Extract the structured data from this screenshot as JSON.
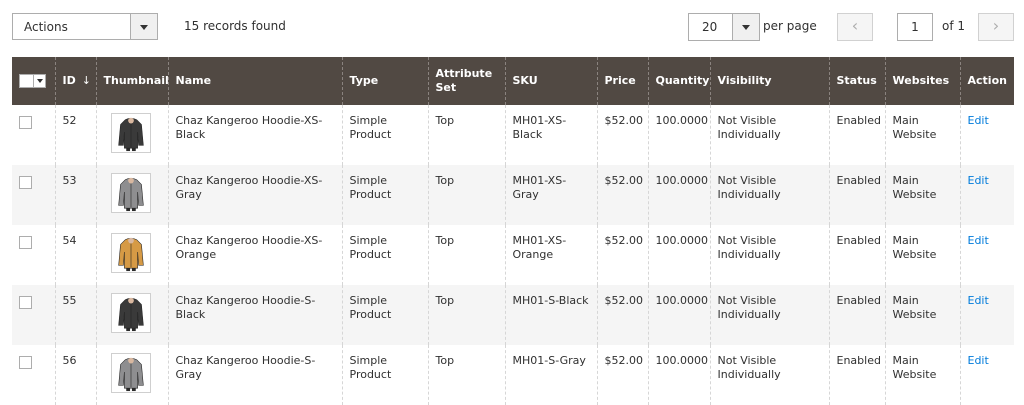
{
  "toolbar": {
    "actions_label": "Actions",
    "records_found": "15 records found",
    "per_page_value": "20",
    "per_page_label": "per page",
    "page_current": "1",
    "page_of": "of 1",
    "prev_glyph": "‹",
    "next_glyph": "›"
  },
  "columns": {
    "id": "ID",
    "id_sort": "↓",
    "thumbnail": "Thumbnail",
    "name": "Name",
    "type": "Type",
    "attribute_set": "Attribute Set",
    "sku": "SKU",
    "price": "Price",
    "quantity": "Quantity",
    "visibility": "Visibility",
    "status": "Status",
    "websites": "Websites",
    "action": "Action"
  },
  "rows": [
    {
      "id": "52",
      "name": "Chaz Kangeroo Hoodie-XS-Black",
      "type": "Simple Product",
      "attribute_set": "Top",
      "sku": "MH01-XS-Black",
      "price": "$52.00",
      "quantity": "100.0000",
      "visibility": "Not Visible Individually",
      "status": "Enabled",
      "websites": "Main Website",
      "action": "Edit",
      "color": "#3a3a3a"
    },
    {
      "id": "53",
      "name": "Chaz Kangeroo Hoodie-XS-Gray",
      "type": "Simple Product",
      "attribute_set": "Top",
      "sku": "MH01-XS-Gray",
      "price": "$52.00",
      "quantity": "100.0000",
      "visibility": "Not Visible Individually",
      "status": "Enabled",
      "websites": "Main Website",
      "action": "Edit",
      "color": "#8e8e90"
    },
    {
      "id": "54",
      "name": "Chaz Kangeroo Hoodie-XS-Orange",
      "type": "Simple Product",
      "attribute_set": "Top",
      "sku": "MH01-XS-Orange",
      "price": "$52.00",
      "quantity": "100.0000",
      "visibility": "Not Visible Individually",
      "status": "Enabled",
      "websites": "Main Website",
      "action": "Edit",
      "color": "#d69a45"
    },
    {
      "id": "55",
      "name": "Chaz Kangeroo Hoodie-S-Black",
      "type": "Simple Product",
      "attribute_set": "Top",
      "sku": "MH01-S-Black",
      "price": "$52.00",
      "quantity": "100.0000",
      "visibility": "Not Visible Individually",
      "status": "Enabled",
      "websites": "Main Website",
      "action": "Edit",
      "color": "#3a3a3a"
    },
    {
      "id": "56",
      "name": "Chaz Kangeroo Hoodie-S-Gray",
      "type": "Simple Product",
      "attribute_set": "Top",
      "sku": "MH01-S-Gray",
      "price": "$52.00",
      "quantity": "100.0000",
      "visibility": "Not Visible Individually",
      "status": "Enabled",
      "websites": "Main Website",
      "action": "Edit",
      "color": "#8e8e90"
    }
  ]
}
